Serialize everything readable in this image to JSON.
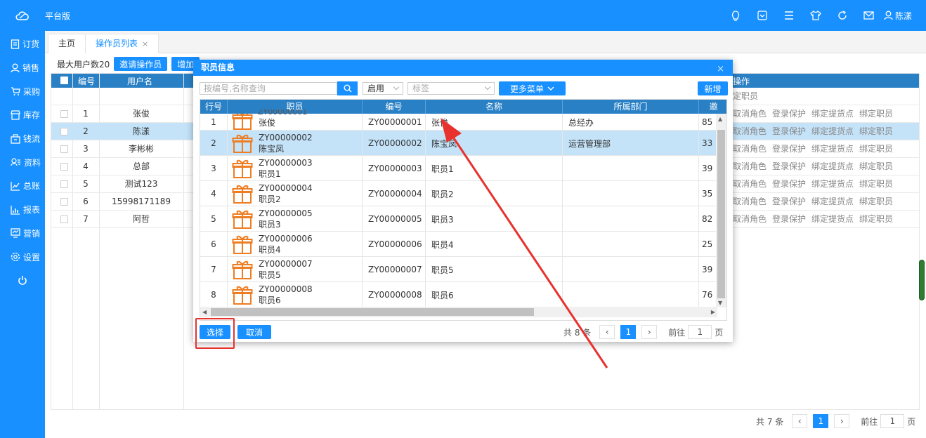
{
  "header": {
    "brand": "平台版",
    "user": "陈漾",
    "icons": [
      "bulb-icon",
      "box-check-icon",
      "menu-icon",
      "shirt-icon",
      "refresh-icon",
      "mail-icon",
      "user-icon"
    ]
  },
  "sidebar": {
    "items": [
      {
        "label": "订货",
        "icon": "doc-icon"
      },
      {
        "label": "销售",
        "icon": "person-icon"
      },
      {
        "label": "采购",
        "icon": "cart-icon"
      },
      {
        "label": "库存",
        "icon": "store-icon"
      },
      {
        "label": "钱流",
        "icon": "wallet-icon"
      },
      {
        "label": "资料",
        "icon": "contacts-icon"
      },
      {
        "label": "总账",
        "icon": "linechart-icon"
      },
      {
        "label": "报表",
        "icon": "barchart-icon"
      },
      {
        "label": "营销",
        "icon": "monitor-icon"
      },
      {
        "label": "设置",
        "icon": "gear-icon"
      }
    ],
    "power_icon": "power-icon"
  },
  "tabs": [
    {
      "label": "主页"
    },
    {
      "label": "操作员列表",
      "close": "×"
    }
  ],
  "toolbar": {
    "max_users": "最大用户数20",
    "invite": "邀请操作员",
    "add": "增加"
  },
  "bgtable": {
    "headers": {
      "num": "编号",
      "name": "用户名",
      "ops": "操作"
    },
    "first_op": "定职员",
    "ops": [
      "取消角色",
      "登录保护",
      "绑定提货点",
      "绑定职员"
    ],
    "rows": [
      {
        "num": "1",
        "name": "张俊"
      },
      {
        "num": "2",
        "name": "陈漾"
      },
      {
        "num": "3",
        "name": "李彬彬"
      },
      {
        "num": "4",
        "name": "总部"
      },
      {
        "num": "5",
        "name": "测试123"
      },
      {
        "num": "6",
        "name": "15998171189"
      },
      {
        "num": "7",
        "name": "阿哲"
      }
    ],
    "selected_row": 1
  },
  "bgpager": {
    "total": "共 7 条",
    "current": "1",
    "goto": "前往",
    "page": "1",
    "unit": "页",
    "prev": "‹",
    "next": "›"
  },
  "modal": {
    "title": "职员信息",
    "close": "×",
    "search_placeholder": "按编号,名称查询",
    "status": "启用",
    "tag_placeholder": "标签",
    "more_menu": "更多菜单",
    "new_btn": "新增",
    "headers": {
      "row": "行号",
      "staff": "职员",
      "code": "编号",
      "name": "名称",
      "dept": "所属部门",
      "extra": "邀"
    },
    "top_partial": "ZY00000001",
    "rows": [
      {
        "row": "1",
        "code": "ZY00000001",
        "line2": "张俊",
        "code2": "ZY00000001",
        "name": "张俊",
        "dept": "总经办",
        "extra": "85"
      },
      {
        "row": "2",
        "code": "ZY00000002",
        "line2": "陈宝凤",
        "code2": "ZY00000002",
        "name": "陈宝凤",
        "dept": "运营管理部",
        "extra": "33"
      },
      {
        "row": "3",
        "code": "ZY00000003",
        "line2": "职员1",
        "code2": "ZY00000003",
        "name": "职员1",
        "dept": "",
        "extra": "39"
      },
      {
        "row": "4",
        "code": "ZY00000004",
        "line2": "职员2",
        "code2": "ZY00000004",
        "name": "职员2",
        "dept": "",
        "extra": "35"
      },
      {
        "row": "5",
        "code": "ZY00000005",
        "line2": "职员3",
        "code2": "ZY00000005",
        "name": "职员3",
        "dept": "",
        "extra": "82"
      },
      {
        "row": "6",
        "code": "ZY00000006",
        "line2": "职员4",
        "code2": "ZY00000006",
        "name": "职员4",
        "dept": "",
        "extra": "25"
      },
      {
        "row": "7",
        "code": "ZY00000007",
        "line2": "职员5",
        "code2": "ZY00000007",
        "name": "职员5",
        "dept": "",
        "extra": "39"
      },
      {
        "row": "8",
        "code": "ZY00000008",
        "line2": "职员6",
        "code2": "ZY00000008",
        "name": "职员6",
        "dept": "",
        "extra": "76"
      }
    ],
    "selected_row": 1,
    "select_btn": "选择",
    "cancel_btn": "取消",
    "pager": {
      "total": "共 8 条",
      "current": "1",
      "goto": "前往",
      "page": "1",
      "unit": "页",
      "prev": "‹",
      "next": "›"
    }
  },
  "colors": {
    "primary": "#1890ff",
    "table_head": "#2a80c5",
    "selected": "#c4e3f9",
    "gift": "#ef7d22",
    "annotation": "#e8322d"
  }
}
